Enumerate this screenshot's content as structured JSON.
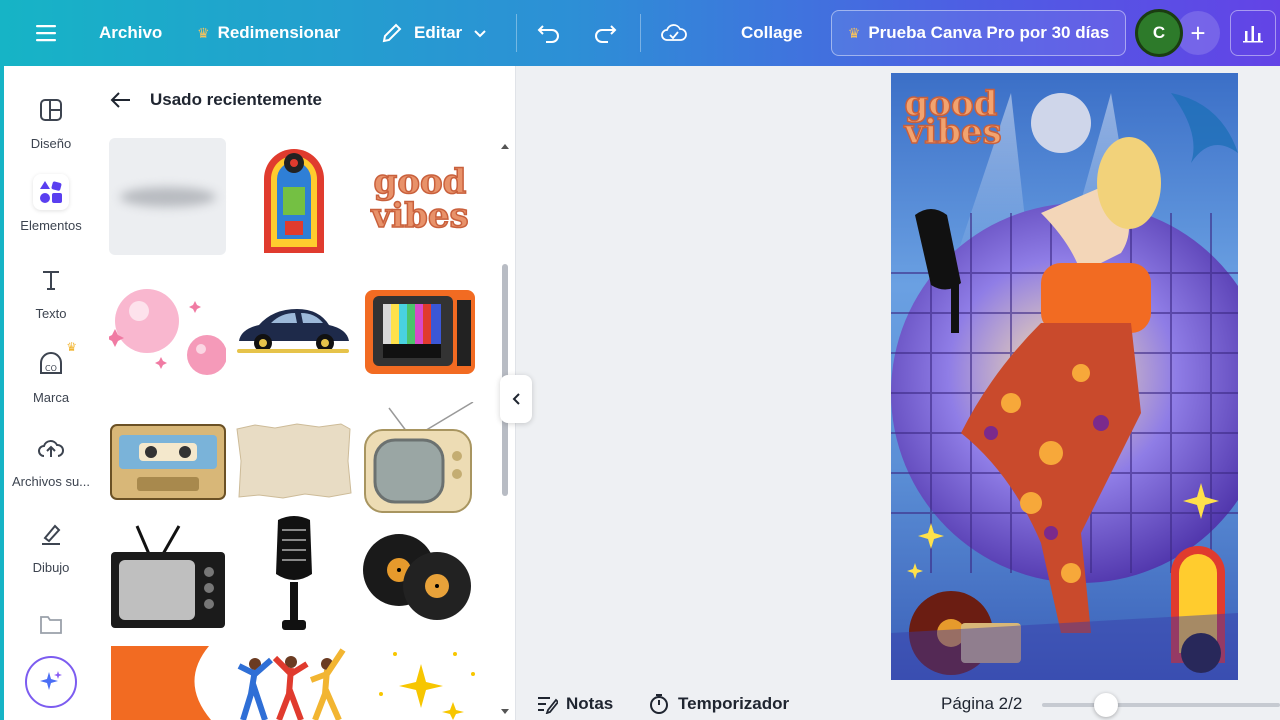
{
  "topbar": {
    "menu_icon": "hamburger-icon",
    "archivo": "Archivo",
    "redimensionar": "Redimensionar",
    "editar": "Editar",
    "title": "Collage",
    "pro_trial": "Prueba Canva Pro por 30 días",
    "avatar_letter": "C"
  },
  "rail": {
    "items": [
      {
        "label": "Diseño",
        "icon": "layout-icon"
      },
      {
        "label": "Elementos",
        "icon": "shapes-icon"
      },
      {
        "label": "Texto",
        "icon": "text-icon"
      },
      {
        "label": "Marca",
        "icon": "brand-icon"
      },
      {
        "label": "Archivos su...",
        "icon": "upload-icon"
      },
      {
        "label": "Dibujo",
        "icon": "draw-icon"
      }
    ]
  },
  "panel": {
    "heading": "Usado recientemente",
    "items": [
      "Sombra difusa",
      "Rocola",
      "Good vibes",
      "Burbujas de chicle",
      "Auto clásico",
      "Televisor naranja",
      "Casete",
      "Papel rasgado",
      "Televisor retro",
      "Televisor antiguo",
      "Micrófono",
      "Discos de vinilo",
      "Forma naranja",
      "Bailarines",
      "Destellos"
    ]
  },
  "canvas": {
    "sticker_text_1": "good",
    "sticker_text_2": "vibes"
  },
  "bottombar": {
    "notas": "Notas",
    "temporizador": "Temporizador",
    "pagina": "Página 2/2"
  },
  "colors": {
    "accent": "#16b4c6",
    "violet": "#6343e6",
    "orange": "#f26b22"
  }
}
